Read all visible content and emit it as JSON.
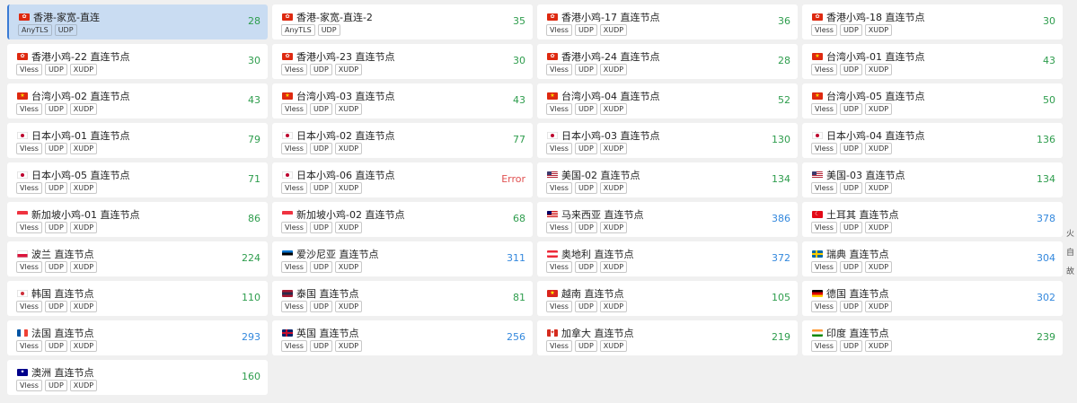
{
  "colors": {
    "green": "#2e9d4d",
    "blue": "#3388dd",
    "red": "#e05050"
  },
  "sidebar": [
    "火",
    "自",
    "故"
  ],
  "proxies": [
    {
      "name": "香港-家宽-直连",
      "flag": "hk",
      "tags": [
        "AnyTLS",
        "UDP"
      ],
      "delay": "28",
      "level": "good",
      "selected": true
    },
    {
      "name": "香港-家宽-直连-2",
      "flag": "hk",
      "tags": [
        "AnyTLS",
        "UDP"
      ],
      "delay": "35",
      "level": "good"
    },
    {
      "name": "香港小鸡-17 直连节点",
      "flag": "hk",
      "tags": [
        "Vless",
        "UDP",
        "XUDP"
      ],
      "delay": "36",
      "level": "good"
    },
    {
      "name": "香港小鸡-18 直连节点",
      "flag": "hk",
      "tags": [
        "Vless",
        "UDP",
        "XUDP"
      ],
      "delay": "30",
      "level": "good"
    },
    {
      "name": "香港小鸡-22 直连节点",
      "flag": "hk",
      "tags": [
        "Vless",
        "UDP",
        "XUDP"
      ],
      "delay": "30",
      "level": "good"
    },
    {
      "name": "香港小鸡-23 直连节点",
      "flag": "hk",
      "tags": [
        "Vless",
        "UDP",
        "XUDP"
      ],
      "delay": "30",
      "level": "good"
    },
    {
      "name": "香港小鸡-24 直连节点",
      "flag": "hk",
      "tags": [
        "Vless",
        "UDP",
        "XUDP"
      ],
      "delay": "28",
      "level": "good"
    },
    {
      "name": "台湾小鸡-01 直连节点",
      "flag": "cn",
      "tags": [
        "Vless",
        "UDP",
        "XUDP"
      ],
      "delay": "43",
      "level": "good"
    },
    {
      "name": "台湾小鸡-02 直连节点",
      "flag": "cn",
      "tags": [
        "Vless",
        "UDP",
        "XUDP"
      ],
      "delay": "43",
      "level": "good"
    },
    {
      "name": "台湾小鸡-03 直连节点",
      "flag": "cn",
      "tags": [
        "Vless",
        "UDP",
        "XUDP"
      ],
      "delay": "43",
      "level": "good"
    },
    {
      "name": "台湾小鸡-04 直连节点",
      "flag": "cn",
      "tags": [
        "Vless",
        "UDP",
        "XUDP"
      ],
      "delay": "52",
      "level": "good"
    },
    {
      "name": "台湾小鸡-05 直连节点",
      "flag": "cn",
      "tags": [
        "Vless",
        "UDP",
        "XUDP"
      ],
      "delay": "50",
      "level": "good"
    },
    {
      "name": "日本小鸡-01 直连节点",
      "flag": "jp",
      "tags": [
        "Vless",
        "UDP",
        "XUDP"
      ],
      "delay": "79",
      "level": "good"
    },
    {
      "name": "日本小鸡-02 直连节点",
      "flag": "jp",
      "tags": [
        "Vless",
        "UDP",
        "XUDP"
      ],
      "delay": "77",
      "level": "good"
    },
    {
      "name": "日本小鸡-03 直连节点",
      "flag": "jp",
      "tags": [
        "Vless",
        "UDP",
        "XUDP"
      ],
      "delay": "130",
      "level": "good"
    },
    {
      "name": "日本小鸡-04 直连节点",
      "flag": "jp",
      "tags": [
        "Vless",
        "UDP",
        "XUDP"
      ],
      "delay": "136",
      "level": "good"
    },
    {
      "name": "日本小鸡-05 直连节点",
      "flag": "jp",
      "tags": [
        "Vless",
        "UDP",
        "XUDP"
      ],
      "delay": "71",
      "level": "good"
    },
    {
      "name": "日本小鸡-06 直连节点",
      "flag": "jp",
      "tags": [
        "Vless",
        "UDP",
        "XUDP"
      ],
      "delay": "Error",
      "level": "error"
    },
    {
      "name": "美国-02 直连节点",
      "flag": "us",
      "tags": [
        "Vless",
        "UDP",
        "XUDP"
      ],
      "delay": "134",
      "level": "good"
    },
    {
      "name": "美国-03 直连节点",
      "flag": "us",
      "tags": [
        "Vless",
        "UDP",
        "XUDP"
      ],
      "delay": "134",
      "level": "good"
    },
    {
      "name": "新加坡小鸡-01 直连节点",
      "flag": "sg",
      "tags": [
        "Vless",
        "UDP",
        "XUDP"
      ],
      "delay": "86",
      "level": "good"
    },
    {
      "name": "新加坡小鸡-02 直连节点",
      "flag": "sg",
      "tags": [
        "Vless",
        "UDP",
        "XUDP"
      ],
      "delay": "68",
      "level": "good"
    },
    {
      "name": "马来西亚 直连节点",
      "flag": "my",
      "tags": [
        "Vless",
        "UDP",
        "XUDP"
      ],
      "delay": "386",
      "level": "slow"
    },
    {
      "name": "土耳其 直连节点",
      "flag": "tr",
      "tags": [
        "Vless",
        "UDP",
        "XUDP"
      ],
      "delay": "378",
      "level": "slow"
    },
    {
      "name": "波兰 直连节点",
      "flag": "pl",
      "tags": [
        "Vless",
        "UDP",
        "XUDP"
      ],
      "delay": "224",
      "level": "good"
    },
    {
      "name": "爱沙尼亚 直连节点",
      "flag": "ee",
      "tags": [
        "Vless",
        "UDP",
        "XUDP"
      ],
      "delay": "311",
      "level": "slow"
    },
    {
      "name": "奥地利 直连节点",
      "flag": "at",
      "tags": [
        "Vless",
        "UDP",
        "XUDP"
      ],
      "delay": "372",
      "level": "slow"
    },
    {
      "name": "瑞典 直连节点",
      "flag": "se",
      "tags": [
        "Vless",
        "UDP",
        "XUDP"
      ],
      "delay": "304",
      "level": "slow"
    },
    {
      "name": "韩国 直连节点",
      "flag": "kr",
      "tags": [
        "Vless",
        "UDP",
        "XUDP"
      ],
      "delay": "110",
      "level": "good"
    },
    {
      "name": "泰国 直连节点",
      "flag": "th",
      "tags": [
        "Vless",
        "UDP",
        "XUDP"
      ],
      "delay": "81",
      "level": "good"
    },
    {
      "name": "越南 直连节点",
      "flag": "vn",
      "tags": [
        "Vless",
        "UDP",
        "XUDP"
      ],
      "delay": "105",
      "level": "good"
    },
    {
      "name": "德国 直连节点",
      "flag": "de",
      "tags": [
        "Vless",
        "UDP",
        "XUDP"
      ],
      "delay": "302",
      "level": "slow"
    },
    {
      "name": "法国 直连节点",
      "flag": "fr",
      "tags": [
        "Vless",
        "UDP",
        "XUDP"
      ],
      "delay": "293",
      "level": "slow"
    },
    {
      "name": "英国 直连节点",
      "flag": "gb",
      "tags": [
        "Vless",
        "UDP",
        "XUDP"
      ],
      "delay": "256",
      "level": "slow"
    },
    {
      "name": "加拿大 直连节点",
      "flag": "ca",
      "tags": [
        "Vless",
        "UDP",
        "XUDP"
      ],
      "delay": "219",
      "level": "good"
    },
    {
      "name": "印度 直连节点",
      "flag": "in",
      "tags": [
        "Vless",
        "UDP",
        "XUDP"
      ],
      "delay": "239",
      "level": "good"
    },
    {
      "name": "澳洲 直连节点",
      "flag": "au",
      "tags": [
        "Vless",
        "UDP",
        "XUDP"
      ],
      "delay": "160",
      "level": "good"
    }
  ]
}
